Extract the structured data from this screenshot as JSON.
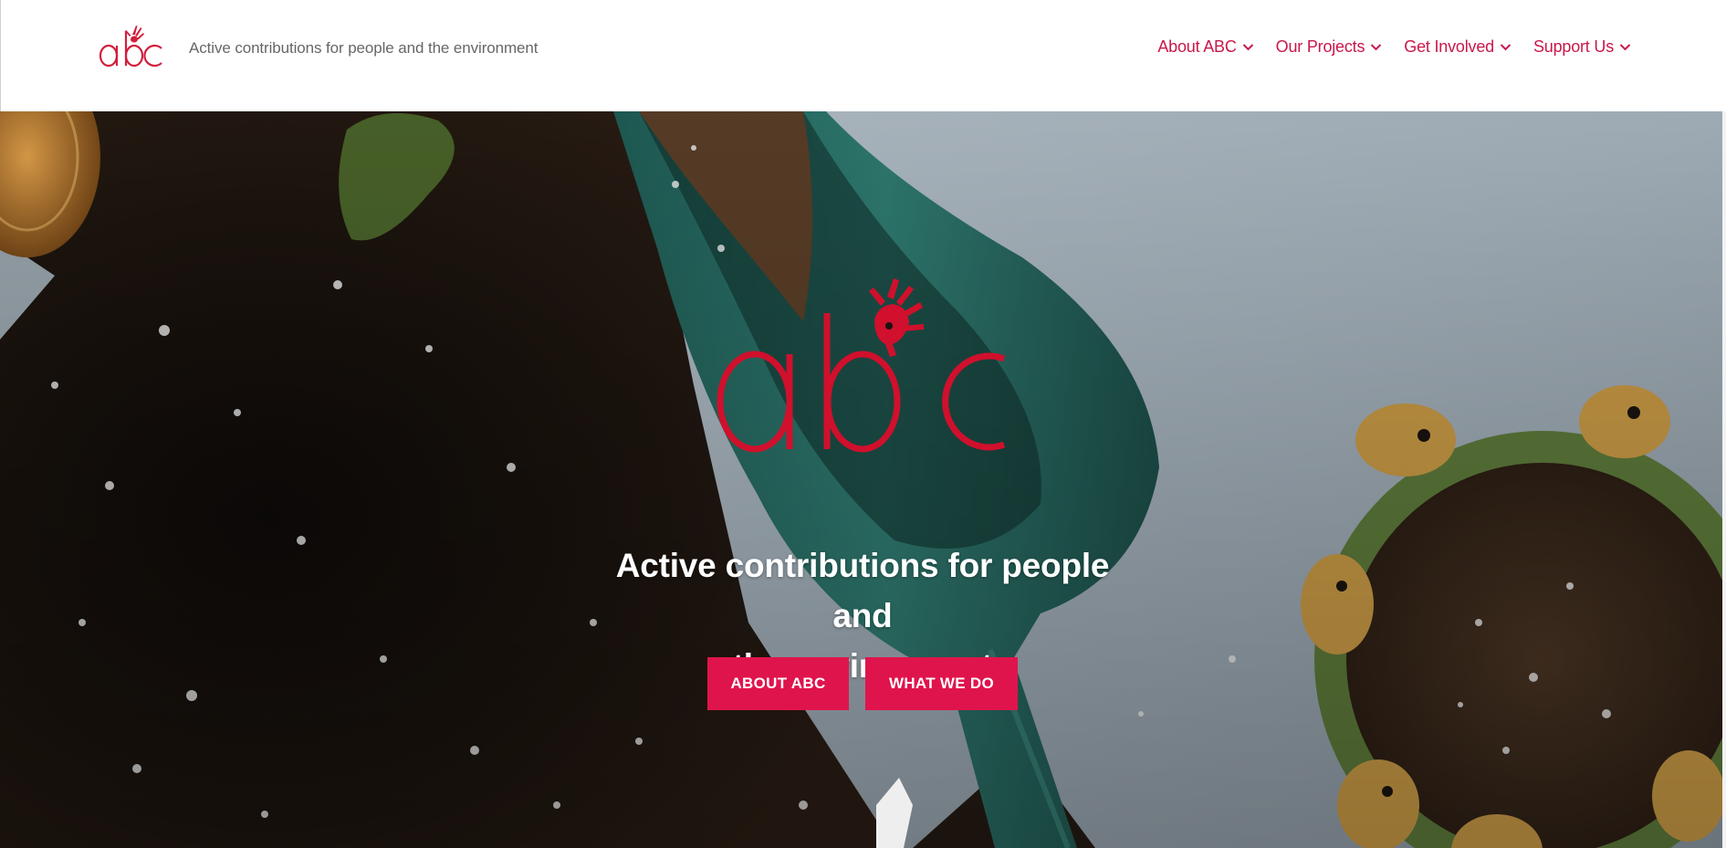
{
  "header": {
    "logo_text": "abc",
    "tagline": "Active contributions for people and the environment",
    "nav": [
      {
        "label": "About ABC",
        "icon": "chevron-down-icon"
      },
      {
        "label": "Our Projects",
        "icon": "chevron-down-icon"
      },
      {
        "label": "Get Involved",
        "icon": "chevron-down-icon"
      },
      {
        "label": "Support Us",
        "icon": "chevron-down-icon"
      }
    ]
  },
  "hero": {
    "logo_text": "abc",
    "title_line1": "Active contributions for people and",
    "title_line2": "the environment",
    "buttons": {
      "about": "ABOUT ABC",
      "what_we_do": "WHAT WE DO"
    },
    "background": "soil-and-garden-trowel-photo"
  },
  "colors": {
    "brand_red": "#e0144c",
    "nav_text": "#c9184a",
    "tagline_text": "#666666",
    "logo_red": "#d21f3c"
  }
}
